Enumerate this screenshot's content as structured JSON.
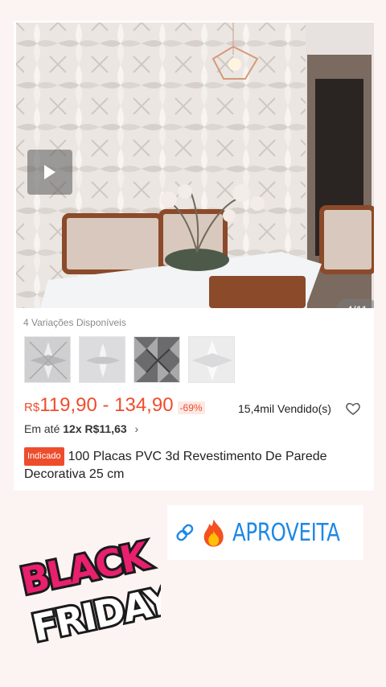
{
  "gallery": {
    "counter": "4/11",
    "play": "play-icon"
  },
  "variants": {
    "label": "4 Variações Disponíveis",
    "count": 4
  },
  "price": {
    "currency": "R$",
    "value": "119,90 - 134,90",
    "discount": "-69%"
  },
  "sold": "15,4mil Vendido(s)",
  "installments": {
    "prefix": "Em até",
    "value": "12x R$11,63",
    "chevron": "›"
  },
  "product": {
    "badge": "Indicado",
    "title": "100 Placas PVC 3d Revestimento De Parede Decorativa 25 cm"
  },
  "promo": {
    "text": "APROVEITA",
    "link_icon": "link-icon",
    "fire_icon": "fire-icon"
  },
  "banner": {
    "line1": "BLACK",
    "line2": "FRIDAY"
  },
  "colors": {
    "accent": "#ee4d2d",
    "promo": "#1e88e5",
    "banner_pink": "#e8206e"
  }
}
